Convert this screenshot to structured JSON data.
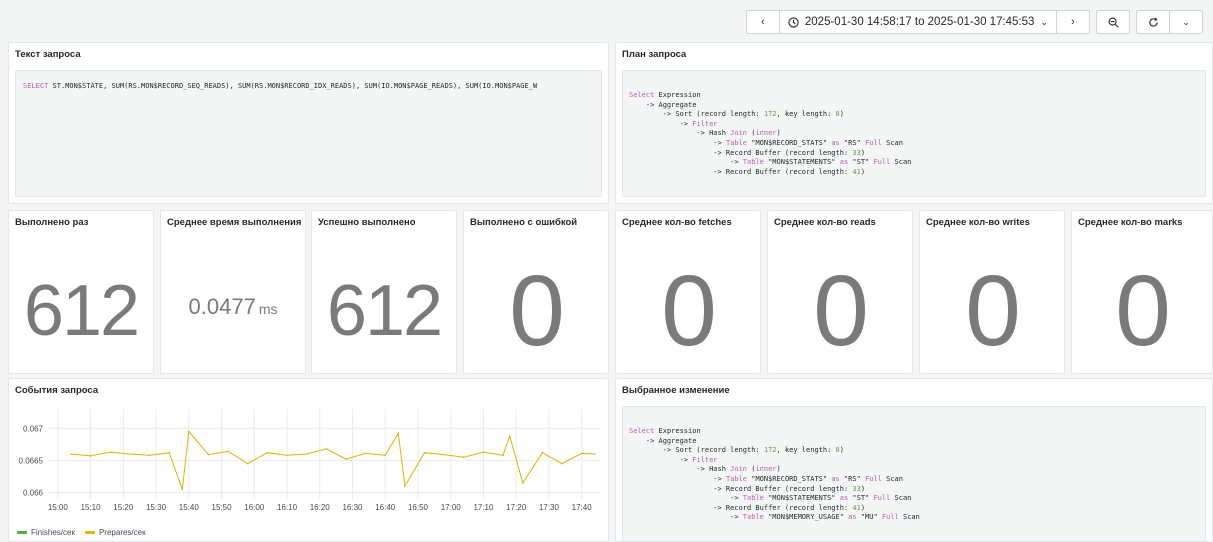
{
  "toolbar": {
    "prev_icon": "chevron-left-icon",
    "clock_icon": "clock-icon",
    "time_range": "2025-01-30 14:58:17 to 2025-01-30 17:45:53",
    "next_icon": "chevron-right-icon",
    "zoom_out_icon": "zoom-out-icon",
    "refresh_icon": "refresh-icon"
  },
  "panels": {
    "query_text": {
      "title": "Текст запроса",
      "sql": "SELECT ST.MON$STATE, SUM(RS.MON$RECORD_SEQ_READS), SUM(RS.MON$RECORD_IDX_READS), SUM(IO.MON$PAGE_READS), SUM(IO.MON$PAGE_W"
    },
    "query_plan": {
      "title": "План запроса",
      "lines": [
        "Select Expression",
        "    -> Aggregate",
        "        -> Sort (record length: 172, key length: 8)",
        "            -> Filter",
        "                -> Hash Join (inner)",
        "                    -> Table \"MON$RECORD_STATS\" as \"RS\" Full Scan",
        "                    -> Record Buffer (record length: 33)",
        "                        -> Table \"MON$STATEMENTS\" as \"ST\" Full Scan",
        "                    -> Record Buffer (record length: 41)"
      ]
    },
    "stats": [
      {
        "title": "Выполнено раз",
        "value": "612",
        "unit": ""
      },
      {
        "title": "Среднее время выполнения",
        "value": "0.0477",
        "unit": "ms"
      },
      {
        "title": "Успешно выполнено",
        "value": "612",
        "unit": ""
      },
      {
        "title": "Выполнено с ошибкой",
        "value": "0",
        "unit": ""
      },
      {
        "title": "Среднее кол-во fetches",
        "value": "0",
        "unit": ""
      },
      {
        "title": "Среднее кол-во reads",
        "value": "0",
        "unit": ""
      },
      {
        "title": "Среднее кол-во writes",
        "value": "0",
        "unit": ""
      },
      {
        "title": "Среднее кол-во marks",
        "value": "0",
        "unit": ""
      }
    ],
    "events": {
      "title": "События запроса"
    },
    "selected_change": {
      "title": "Выбранное изменение",
      "lines": [
        "Select Expression",
        "    -> Aggregate",
        "        -> Sort (record length: 172, key length: 8)",
        "            -> Filter",
        "                -> Hash Join (inner)",
        "                    -> Table \"MON$RECORD_STATS\" as \"RS\" Full Scan",
        "                    -> Record Buffer (record length: 33)",
        "                        -> Table \"MON$STATEMENTS\" as \"ST\" Full Scan",
        "                    -> Record Buffer (record length: 41)",
        "                        -> Table \"MON$MEMORY_USAGE\" as \"MU\" Full Scan"
      ]
    }
  },
  "colors": {
    "finishes": "#56a64b",
    "prepares": "#e0b400",
    "stat_text": "#7a7a7a"
  },
  "chart_data": {
    "type": "line",
    "title": "",
    "xlabel": "",
    "ylabel": "",
    "ylim": [
      0.0659,
      0.0673
    ],
    "y_ticks": [
      "0.066",
      "0.0665",
      "0.067"
    ],
    "x_ticks": [
      "15:00",
      "15:10",
      "15:20",
      "15:30",
      "15:40",
      "15:50",
      "16:00",
      "16:10",
      "16:20",
      "16:30",
      "16:40",
      "16:50",
      "17:00",
      "17:10",
      "17:20",
      "17:30",
      "17:40"
    ],
    "x_tick_minutes": [
      900,
      910,
      920,
      930,
      940,
      950,
      960,
      970,
      980,
      990,
      1000,
      1010,
      1020,
      1030,
      1040,
      1050,
      1060
    ],
    "xlim_minutes": [
      897.3,
      1065.9
    ],
    "legend_position": "bottom-left",
    "series": [
      {
        "name": "Finishes/сек",
        "x": [],
        "values": []
      },
      {
        "name": "Prepares/сек",
        "x": [
          904,
          910,
          916,
          922,
          928,
          934,
          938,
          940,
          946,
          952,
          958,
          964,
          970,
          976,
          982,
          988,
          994,
          1000,
          1004,
          1006,
          1012,
          1018,
          1024,
          1030,
          1036,
          1038,
          1042,
          1048,
          1054,
          1060,
          1064
        ],
        "values": [
          0.0666,
          0.06657,
          0.06663,
          0.0666,
          0.06658,
          0.06662,
          0.06605,
          0.06695,
          0.06659,
          0.06664,
          0.06645,
          0.06662,
          0.06658,
          0.0666,
          0.06668,
          0.06652,
          0.06661,
          0.06658,
          0.06692,
          0.0661,
          0.06662,
          0.06659,
          0.06655,
          0.06663,
          0.06658,
          0.06688,
          0.06615,
          0.06662,
          0.06645,
          0.06661,
          0.0666
        ]
      }
    ]
  }
}
